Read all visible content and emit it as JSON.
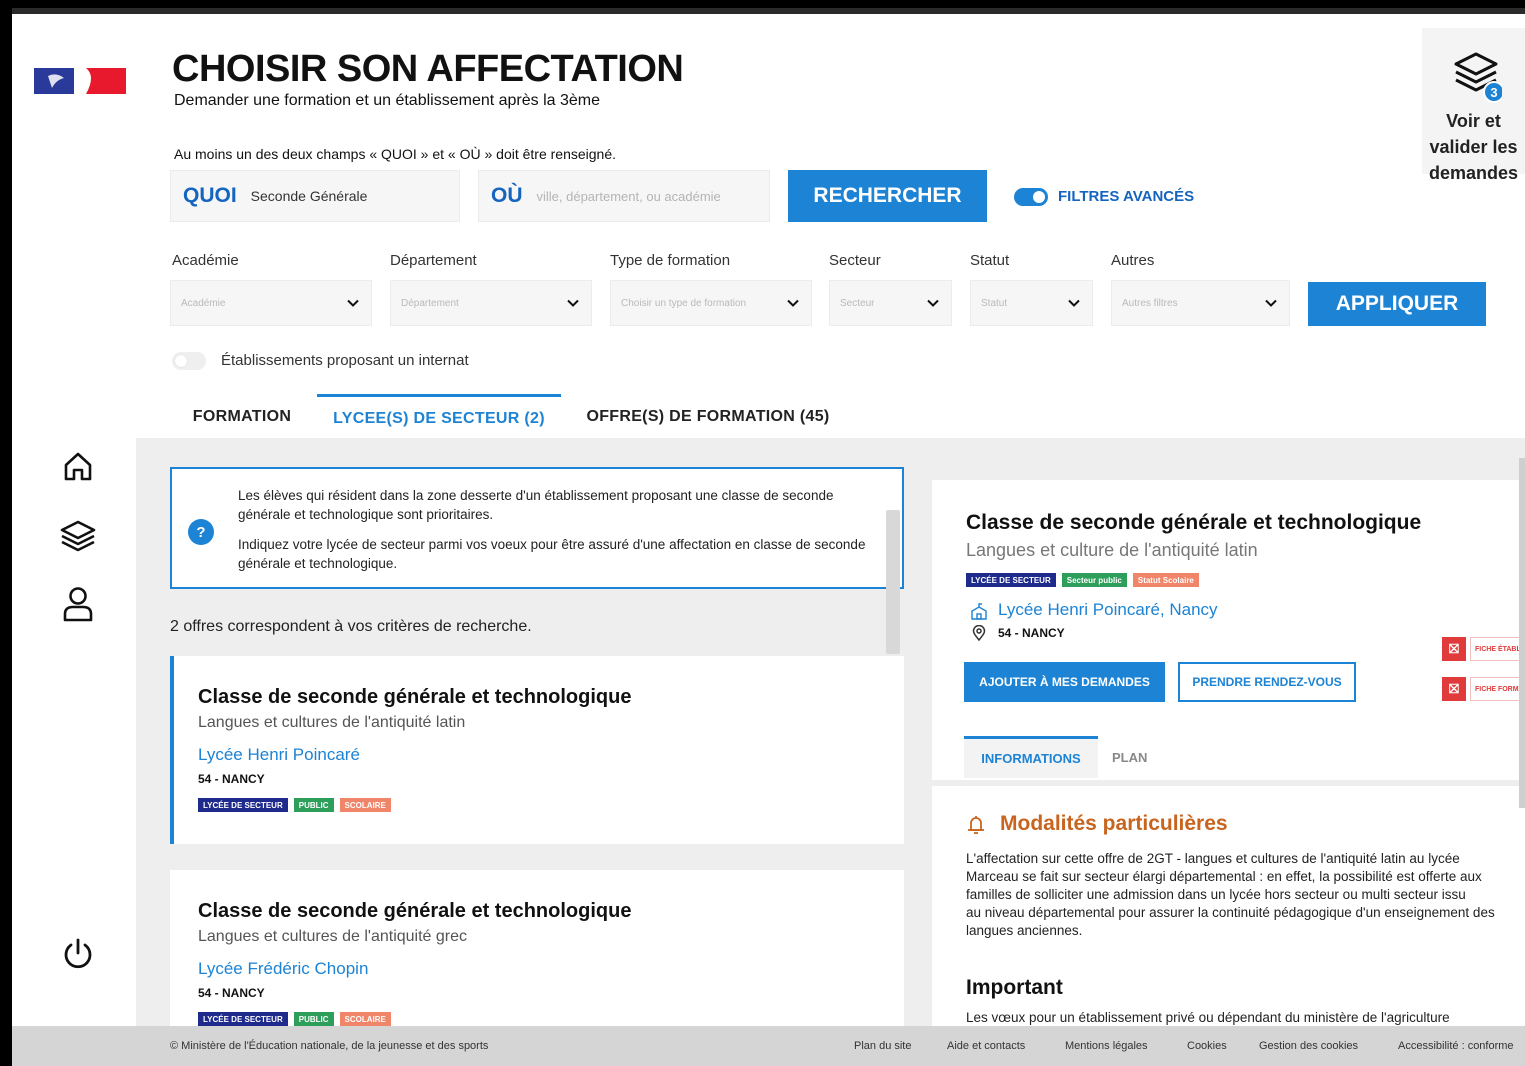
{
  "header": {
    "title": "CHOISIR SON AFFECTATION",
    "subtitle": "Demander une formation et un établissement après la 3ème",
    "hint": "Au moins un des deux champs « QUOI » et « OÙ » doit être renseigné.",
    "demandes_label": "Voir et valider les demandes",
    "demandes_count": "3"
  },
  "search": {
    "quoi_label": "QUOI",
    "quoi_value": "Seconde Générale",
    "ou_label": "OÙ",
    "ou_placeholder": "ville, département, ou académie",
    "button": "RECHERCHER",
    "advanced_filters": "FILTRES AVANCÉS"
  },
  "filters": [
    {
      "label": "Académie",
      "placeholder": "Académie"
    },
    {
      "label": "Département",
      "placeholder": "Département"
    },
    {
      "label": "Type de formation",
      "placeholder": "Choisir un type de formation"
    },
    {
      "label": "Secteur",
      "placeholder": "Secteur"
    },
    {
      "label": "Statut",
      "placeholder": "Statut"
    },
    {
      "label": "Autres",
      "placeholder": "Autres filtres"
    }
  ],
  "apply_button": "APPLIQUER",
  "internat_label": "Établissements proposant un internat",
  "tabs": [
    {
      "label": "FORMATION"
    },
    {
      "label": "LYCEE(S) DE SECTEUR (2)"
    },
    {
      "label": "OFFRE(S) DE FORMATION (45)"
    }
  ],
  "info": {
    "p1": "Les élèves qui résident dans la zone desserte d'un établissement proposant une classe de seconde générale et technologique sont prioritaires.",
    "p2": "Indiquez votre lycée de secteur parmi vos voeux pour être assuré d'une affectation en classe de seconde générale et technologique."
  },
  "results_count": "2 offres correspondent à vos critères de recherche.",
  "results": [
    {
      "title": "Classe de seconde générale et technologique",
      "subtitle": "Langues et cultures de l'antiquité latin",
      "etablissement": "Lycée Henri Poincaré",
      "location": "54 - NANCY",
      "badges": [
        "LYCÉE DE SECTEUR",
        "PUBLIC",
        "SCOLAIRE"
      ]
    },
    {
      "title": "Classe de seconde générale et technologique",
      "subtitle": "Langues et cultures de l'antiquité grec",
      "etablissement": "Lycée Frédéric Chopin",
      "location": "54 - NANCY",
      "badges": [
        "LYCÉE DE SECTEUR",
        "PUBLIC",
        "SCOLAIRE"
      ]
    }
  ],
  "detail": {
    "title": "Classe de seconde générale et technologique",
    "subtitle": "Langues et culture de l'antiquité latin",
    "badges": [
      "LYCÉE DE SECTEUR",
      "Secteur public",
      "Statut Scolaire"
    ],
    "etablissement": "Lycée Henri Poincaré, Nancy",
    "location": "54 - NANCY",
    "add_button": "AJOUTER À MES DEMANDES",
    "rdv_button": "PRENDRE RENDEZ-VOUS",
    "fiche1": "FICHE ÉTABLISSEMENT",
    "fiche2": "FICHE FORMATION",
    "tab_info": "INFORMATIONS",
    "tab_plan": "PLAN",
    "modalites_title": "Modalités particulières",
    "modalites_lines": [
      "L'affectation sur cette offre de 2GT - langues et cultures de l'antiquité latin au lycée",
      "Marceau se fait sur secteur élargi départemental : en effet, la possibilité est offerte aux",
      "familles de solliciter une admission dans un lycée hors secteur ou multi secteur issu",
      "au niveau départemental pour assurer la continuité pédagogique d'un enseignement des",
      "langues anciennes."
    ],
    "important_title": "Important",
    "important_text": "Les vœux pour un établissement privé ou dépendant du ministère de l'agriculture"
  },
  "footer": {
    "copyright": "© Ministère de l'Éducation nationale, de la jeunesse et des sports",
    "links": [
      "Plan du site",
      "Aide et contacts",
      "Mentions légales",
      "Cookies",
      "Gestion des cookies",
      "Accessibilité : conforme"
    ]
  },
  "colors": {
    "accent": "#1d83d4",
    "badge_navy": "#1e2a8c",
    "badge_green": "#2e9e5b",
    "badge_orange": "#f0856a",
    "warning": "#c8641e"
  }
}
